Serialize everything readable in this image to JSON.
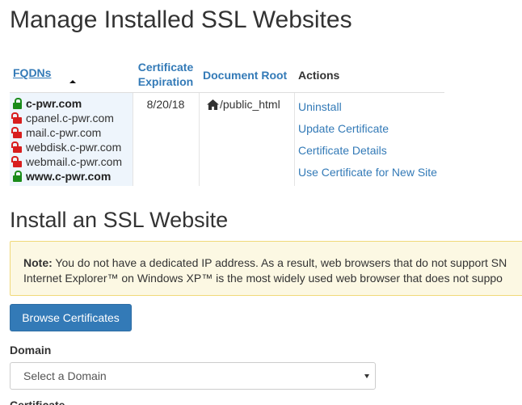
{
  "page_title": "Manage Installed SSL Websites",
  "table": {
    "headers": {
      "fqdns": "FQDNs",
      "expiration": "Certificate Expiration",
      "docroot": "Document Root",
      "actions": "Actions"
    },
    "fqdns": [
      {
        "name": "c-pwr.com",
        "secure": true,
        "bold": true
      },
      {
        "name": "cpanel.c-pwr.com",
        "secure": false,
        "bold": false
      },
      {
        "name": "mail.c-pwr.com",
        "secure": false,
        "bold": false
      },
      {
        "name": "webdisk.c-pwr.com",
        "secure": false,
        "bold": false
      },
      {
        "name": "webmail.c-pwr.com",
        "secure": false,
        "bold": false
      },
      {
        "name": "www.c-pwr.com",
        "secure": true,
        "bold": true
      }
    ],
    "expiration": "8/20/18",
    "docroot": "/public_html",
    "actions": [
      "Uninstall",
      "Update Certificate",
      "Certificate Details",
      "Use Certificate for New Site"
    ]
  },
  "install_title": "Install an SSL Website",
  "note": {
    "label": "Note:",
    "line1": "You do not have a dedicated IP address. As a result, web browsers that do not support SN",
    "line2": "Internet Explorer™ on Windows XP™ is the most widely used web browser that does not suppo"
  },
  "browse_button": "Browse Certificates",
  "domain": {
    "label": "Domain",
    "selected": "Select a Domain"
  },
  "next_label": "Certificate"
}
